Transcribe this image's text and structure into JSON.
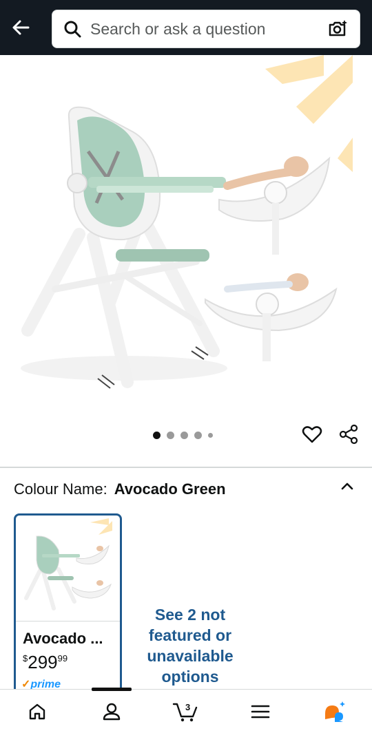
{
  "header": {
    "search_placeholder": "Search or ask a question",
    "background_color": "#131a22"
  },
  "gallery": {
    "image_count": 5,
    "active_index": 0
  },
  "variation": {
    "label": "Colour Name:",
    "selected_value": "Avocado Green"
  },
  "variant_card": {
    "name": "Avocado ...",
    "price_symbol": "$",
    "price_whole": "299",
    "price_fraction": "99",
    "prime_label": "prime",
    "border_color": "#1f5a8f"
  },
  "more_options_link": "See 2 not featured or unavailable options",
  "bottom_nav": {
    "items": [
      "home-icon",
      "account-icon",
      "cart-icon",
      "menu-icon",
      "rufus-icon"
    ],
    "cart_count": "3",
    "active_index": 1
  },
  "colors": {
    "link": "#1f5a8f",
    "accent_orange": "#f08804",
    "prime_blue": "#1a98ff"
  }
}
